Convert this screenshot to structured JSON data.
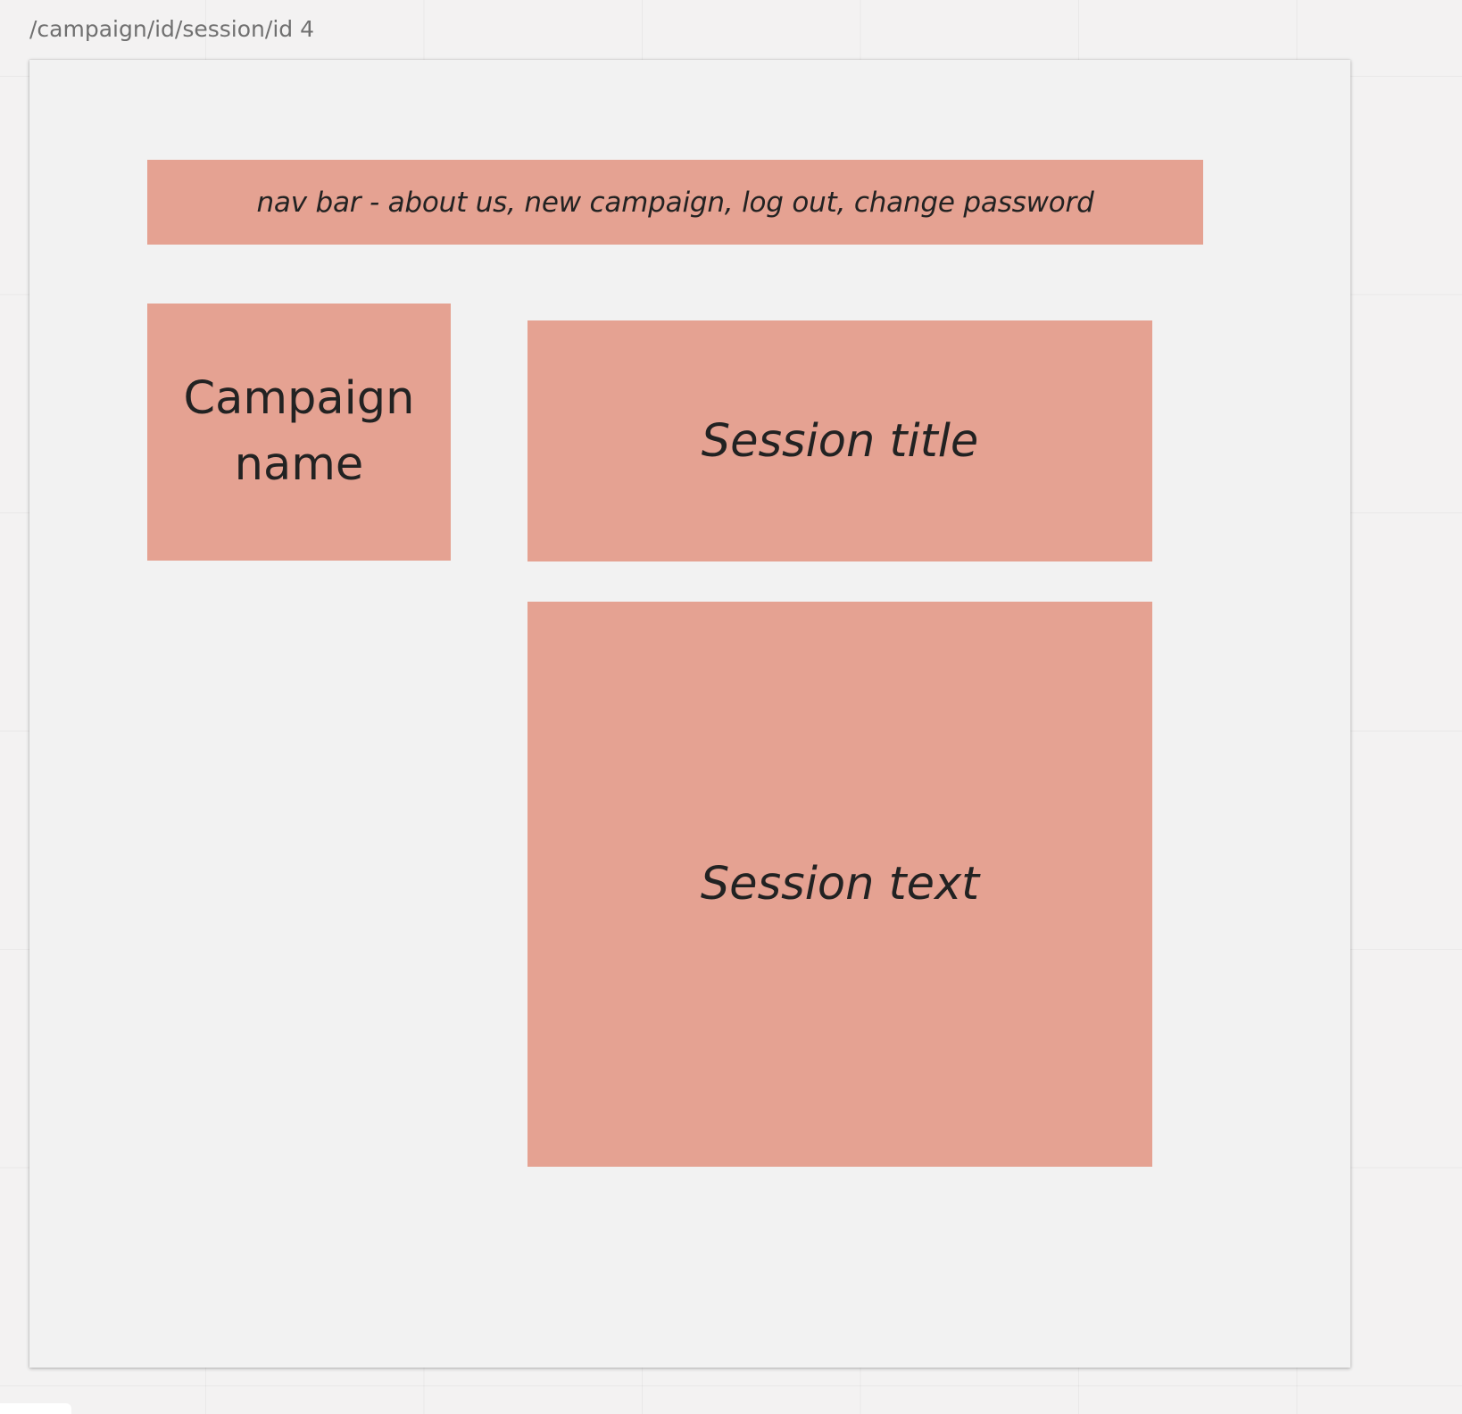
{
  "frame": {
    "label": "/campaign/id/session/id 4"
  },
  "stickies": {
    "nav_bar": "nav bar - about us, new campaign, log out, change password",
    "campaign_name": "Campaign name",
    "session_title": "Session title",
    "session_text": "Session text"
  },
  "colors": {
    "canvas": "#f3f2f2",
    "frame": "#f2f2f2",
    "sticky": "#e5a08f",
    "label_text": "#707070",
    "sticky_text": "#222222"
  }
}
